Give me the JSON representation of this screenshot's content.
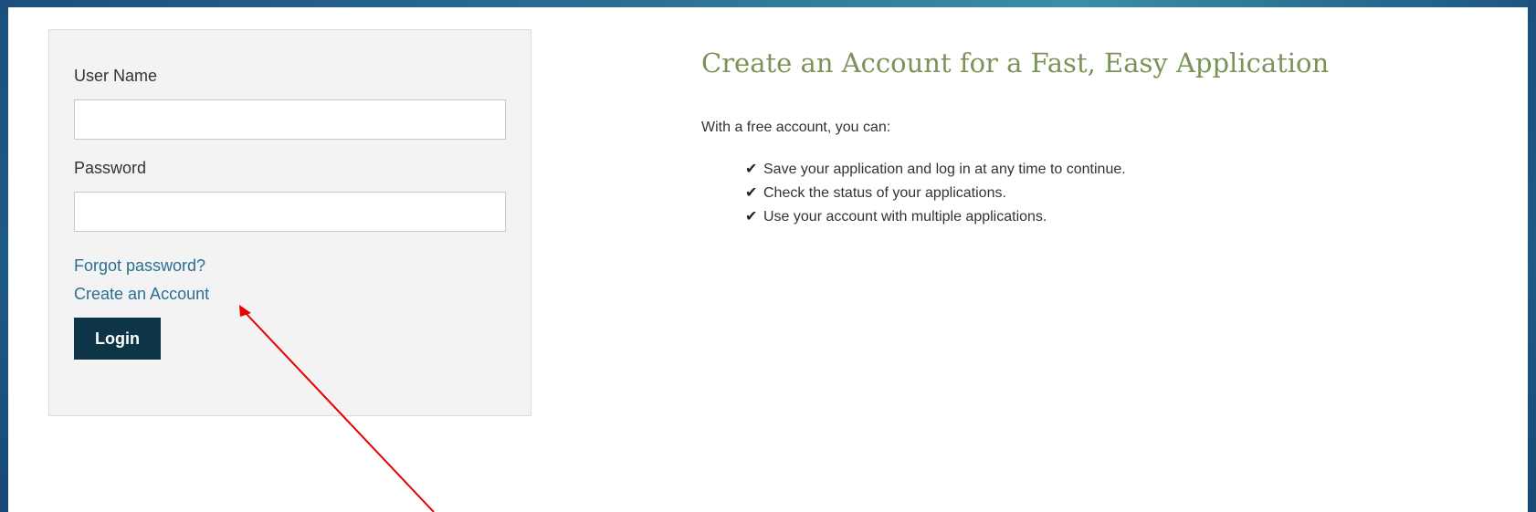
{
  "login": {
    "username_label": "User Name",
    "username_value": "",
    "password_label": "Password",
    "password_value": "",
    "forgot_password_link": "Forgot password?",
    "create_account_link": "Create an Account",
    "login_button": "Login"
  },
  "info": {
    "heading": "Create an Account for a Fast, Easy Application",
    "intro": "With a free account, you can:",
    "benefits": [
      "Save your application and log in at any time to continue.",
      "Check the status of your applications.",
      "Use your account with multiple applications."
    ],
    "check_icon": "check-icon"
  },
  "annotation": {
    "arrow_color": "#e60000",
    "target": "create-account-link"
  },
  "colors": {
    "link": "#2a6f96",
    "button_bg": "#0d3547",
    "heading": "#7a9457",
    "frame": "#1c4f7c"
  }
}
